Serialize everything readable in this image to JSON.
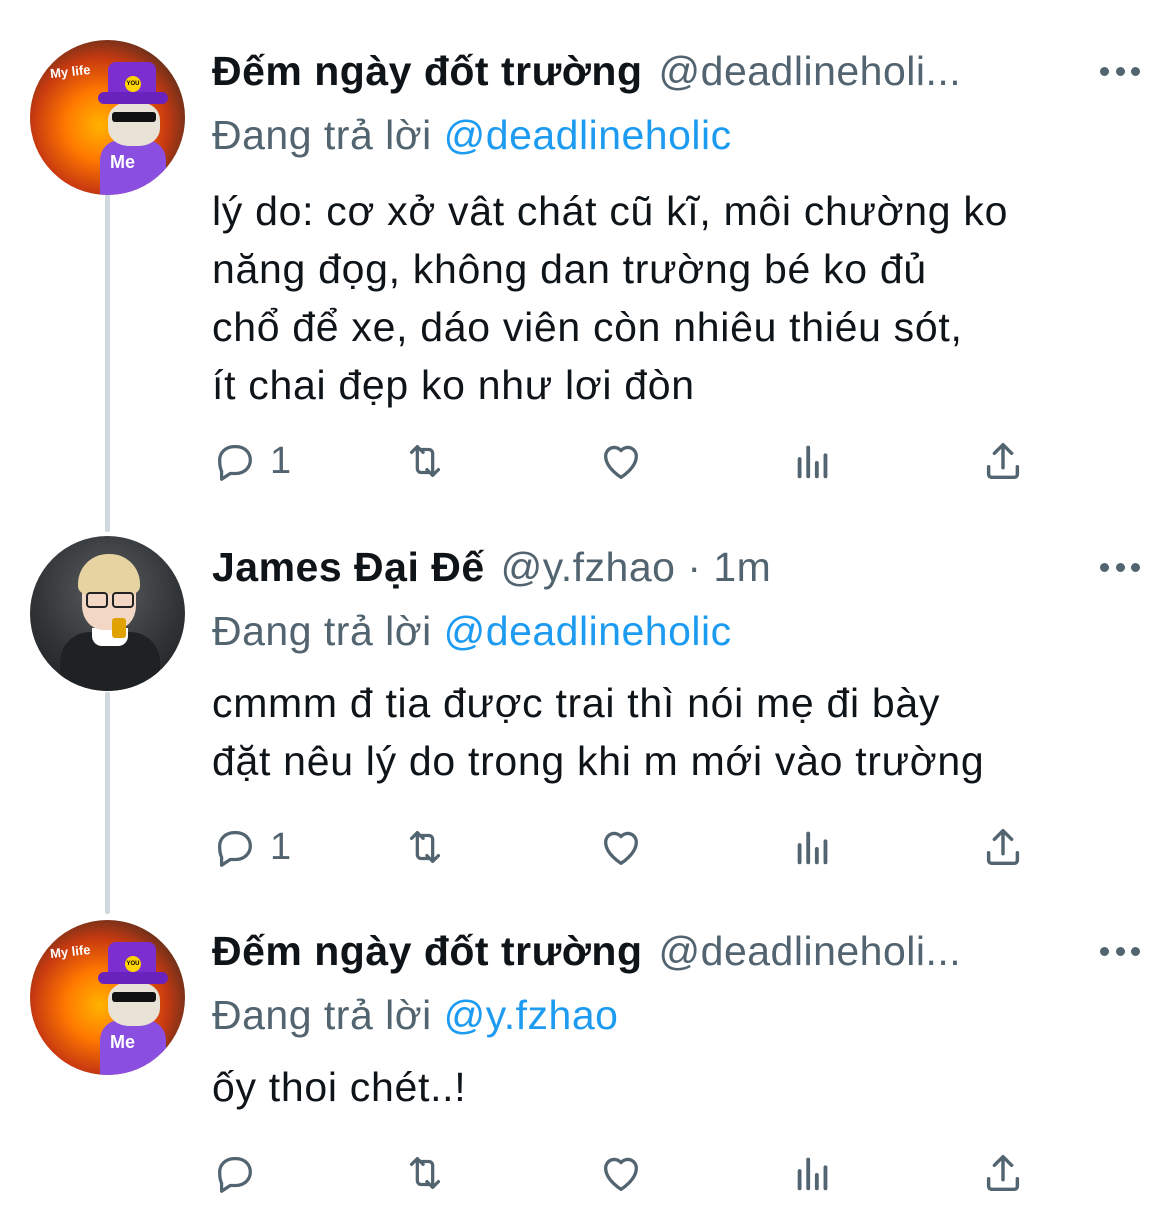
{
  "tweets": [
    {
      "name": "Đếm ngày đốt trường",
      "handle": "@deadlineholi...",
      "reply_prefix": "Đang trả lời",
      "reply_to": "@deadlineholic",
      "lines": [
        "lý do: cơ xở vât chát cũ kĩ, môi chường ko",
        "năng đọg, không dan trường bé ko đủ",
        "chổ để xe, dáo viên còn nhiêu thiéu sót,",
        "ít chai đẹp ko như lơi đòn"
      ],
      "avatar": {
        "top_text": "My life",
        "badge": "YOU",
        "bottom_text": "Me"
      },
      "reply_count": "1"
    },
    {
      "name": "James Đại Đế",
      "handle": "@y.fzhao · 1m",
      "reply_prefix": "Đang trả lời",
      "reply_to": "@deadlineholic",
      "lines": [
        "cmmm đ tia được trai thì nói mẹ đi bày",
        "đặt nêu lý do trong khi m mới vào trường"
      ],
      "reply_count": "1"
    },
    {
      "name": "Đếm ngày đốt trường",
      "handle": "@deadlineholi...",
      "reply_prefix": "Đang trả lời",
      "reply_to": "@y.fzhao",
      "lines": [
        "ốy thoi chét..!"
      ],
      "avatar": {
        "top_text": "My life",
        "badge": "YOU",
        "bottom_text": "Me"
      },
      "reply_count": ""
    }
  ],
  "icons": [
    "reply-icon",
    "retweet-icon",
    "like-icon",
    "views-icon",
    "share-icon",
    "more-icon"
  ],
  "colors": {
    "link": "#1d9bf0",
    "secondary": "#536471",
    "thread_line": "#cfd9de"
  }
}
